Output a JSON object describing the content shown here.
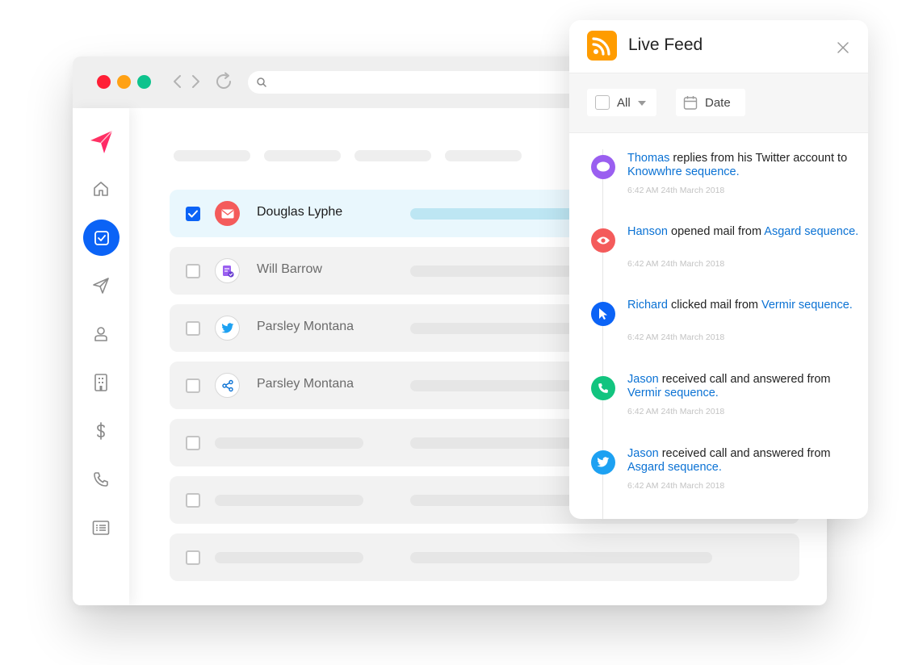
{
  "colors": {
    "brand_blue": "#0b63f6",
    "link_blue": "#0b72d4",
    "rss_orange": "#ff9c00",
    "traffic_red": "#ff1f36",
    "traffic_yellow": "#ffa114",
    "traffic_green": "#0ec38d"
  },
  "browser": {
    "controls": [
      "close-dot",
      "minimize-dot",
      "maximize-dot"
    ],
    "nav_icons": [
      "chevron-left-icon",
      "chevron-right-icon",
      "reload-icon"
    ],
    "search_icon": "search-icon"
  },
  "sidebar": {
    "items": [
      {
        "icon": "paper-plane-logo-icon"
      },
      {
        "icon": "home-icon"
      },
      {
        "icon": "task-check-icon",
        "active": true
      },
      {
        "icon": "send-icon"
      },
      {
        "icon": "user-icon"
      },
      {
        "icon": "building-icon"
      },
      {
        "icon": "dollar-icon"
      },
      {
        "icon": "phone-icon"
      },
      {
        "icon": "list-icon"
      }
    ]
  },
  "main": {
    "rows": [
      {
        "name": "Douglas Lyphe",
        "channel_icon": "mail-icon",
        "checked": true
      },
      {
        "name": "Will Barrow",
        "channel_icon": "task-icon",
        "checked": false
      },
      {
        "name": "Parsley Montana",
        "channel_icon": "twitter-icon",
        "checked": false
      },
      {
        "name": "Parsley Montana",
        "channel_icon": "share-network-icon",
        "checked": false
      },
      {
        "name": "",
        "checked": false
      },
      {
        "name": "",
        "checked": false
      },
      {
        "name": "",
        "checked": false
      }
    ]
  },
  "feed": {
    "title": "Live Feed",
    "filter_all": "All",
    "filter_date": "Date",
    "events": [
      {
        "actor": "Thomas",
        "action": " replies from his Twitter account to ",
        "target": "Knowwhre sequence.",
        "time": "6:42 AM 24th March 2018",
        "icon": "chat-bubble-icon",
        "color": "#9a5ff0"
      },
      {
        "actor": "Hanson",
        "action": " opened mail from ",
        "target": "Asgard sequence.",
        "time": "6:42 AM 24th March 2018",
        "icon": "eye-icon",
        "color": "#f45b5b"
      },
      {
        "actor": "Richard",
        "action": " clicked mail from ",
        "target": "Vermir sequence.",
        "time": "6:42 AM 24th March 2018",
        "icon": "cursor-icon",
        "color": "#0b63f6"
      },
      {
        "actor": "Jason",
        "action": " received call and answered from ",
        "target": "Vermir sequence.",
        "time": "6:42 AM 24th March 2018",
        "icon": "phone-icon",
        "color": "#12c47f"
      },
      {
        "actor": "Jason",
        "action": " received call and answered from ",
        "target": "Asgard sequence.",
        "time": "6:42 AM 24th March 2018",
        "icon": "twitter-icon",
        "color": "#1da1f2"
      }
    ]
  }
}
